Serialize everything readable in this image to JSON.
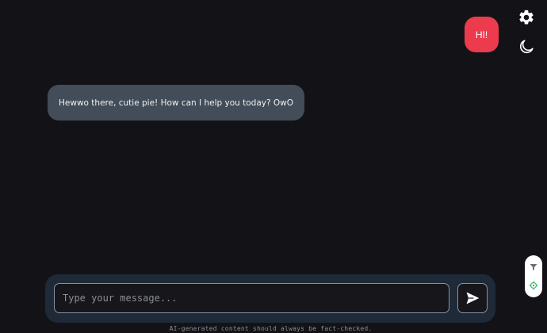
{
  "header": {
    "settings_icon": "gear-icon",
    "theme_icon": "moon-icon"
  },
  "messages": [
    {
      "role": "user",
      "text": "HI!"
    },
    {
      "role": "assistant",
      "text": "Hewwo there, cutie pie! How can I help you today? OwO"
    }
  ],
  "side_controls": {
    "top_icon": "filter-icon",
    "bottom_icon": "gear-small-icon"
  },
  "composer": {
    "placeholder": "Type your message...",
    "value": "",
    "send_icon": "send-icon"
  },
  "footer": {
    "disclaimer": "AI-generated content should always be fact-checked."
  },
  "colors": {
    "background": "#131317",
    "user_bubble": "#ec3b4d",
    "assistant_bubble": "#434c59",
    "composer_bg": "#1f2a38",
    "accent_green": "#3fbf6a"
  }
}
